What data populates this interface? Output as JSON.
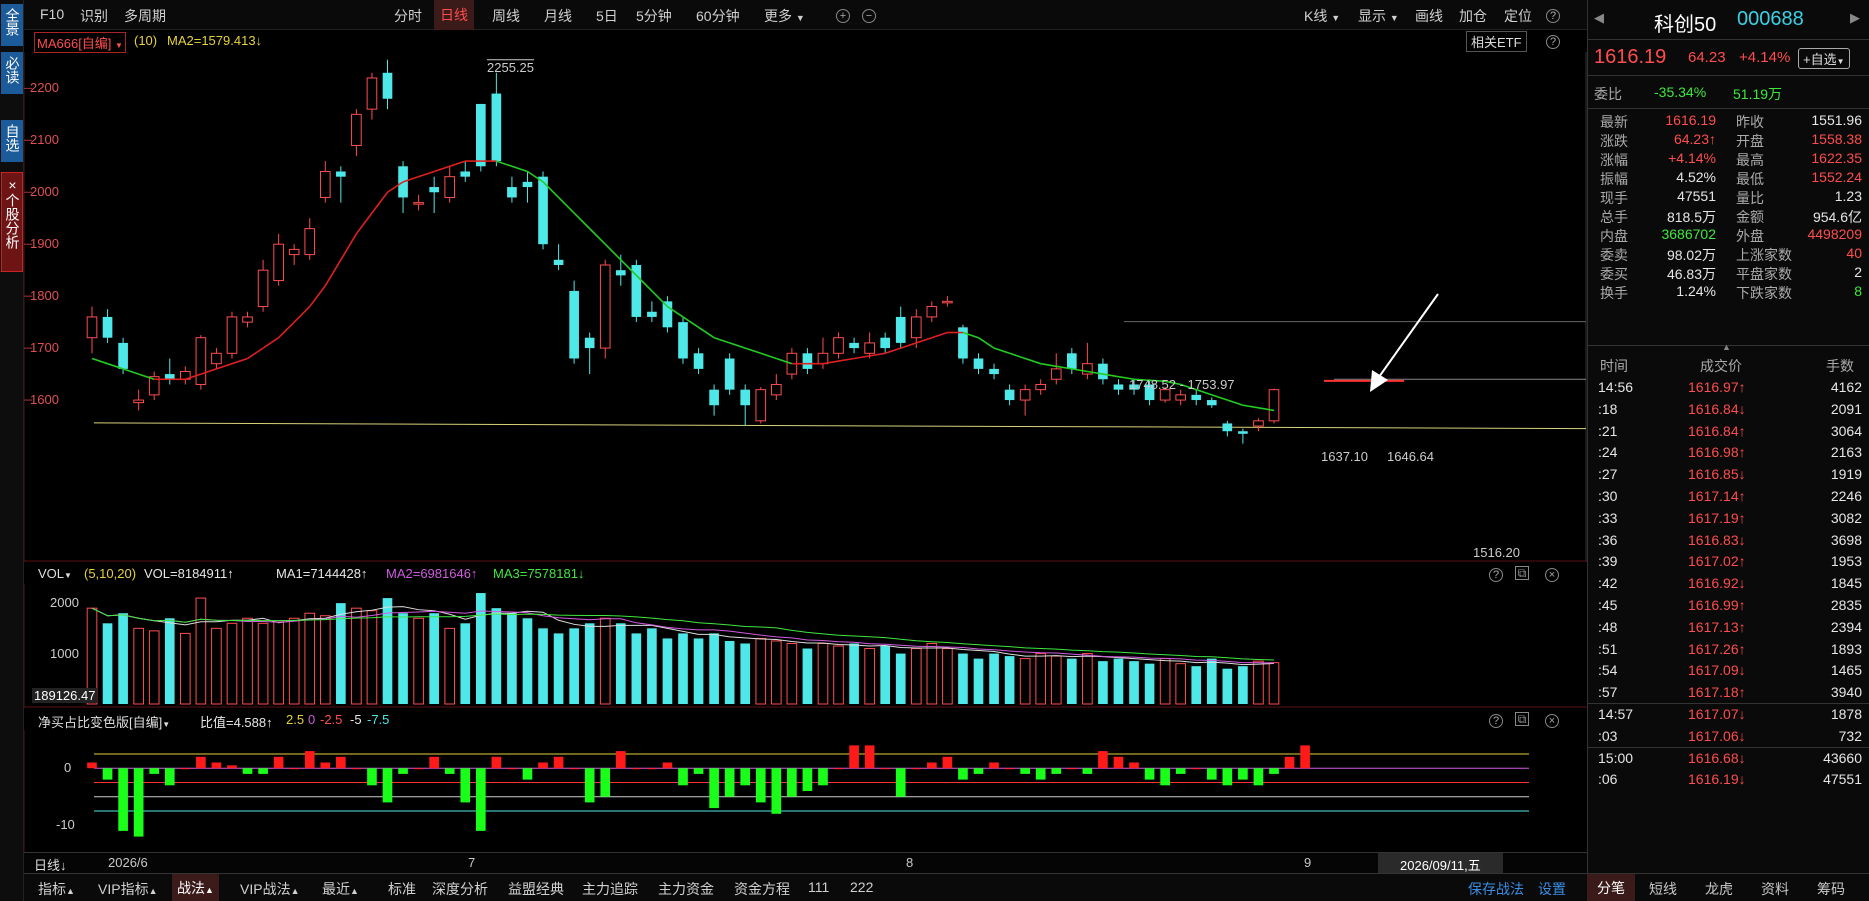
{
  "leftbar": {
    "items": [
      {
        "label": "全景"
      },
      {
        "label": "必读"
      },
      {
        "label": "自选"
      },
      {
        "label": "×个股分析"
      }
    ]
  },
  "topbar": {
    "left": [
      "F10",
      "识别",
      "多周期"
    ],
    "tabs": [
      "分时",
      "日线",
      "周线",
      "月线",
      "5日",
      "5分钟",
      "60分钟",
      "更多"
    ],
    "active_tab": "日线",
    "right": [
      "K线",
      "显示",
      "画线",
      "加仓",
      "定位"
    ]
  },
  "main_chart": {
    "ma_selector": "MA666[自编]",
    "ma_param": "(10)",
    "ma2_label": "MA2=1579.413↓",
    "etf_button": "相关ETF",
    "y_ticks": [
      "2200",
      "2100",
      "2000",
      "1900",
      "1800",
      "1700",
      "1600"
    ],
    "annotations": {
      "high": "2255.25",
      "range1": "1748.52 - 1753.97",
      "p1": "1637.10",
      "p2": "1646.64",
      "low": "1516.20"
    }
  },
  "vol_chart": {
    "selector": "VOL",
    "params": "(5,10,20)",
    "vol": "VOL=8184911↑",
    "ma1": "MA1=7144428↑",
    "ma2": "MA2=6981646↑",
    "ma3": "MA3=7578181↓",
    "y_ticks": [
      "2000",
      "1000"
    ],
    "cursor_value": "189126.47"
  },
  "net_chart": {
    "selector": "净买占比变色版[自编]",
    "ratio": "比值=4.588↑",
    "levels": [
      "2.5",
      "0",
      "-2.5",
      "-5",
      "-7.5"
    ],
    "y_ticks": [
      "0",
      "-10"
    ]
  },
  "x_axis": {
    "period_selector": "日线",
    "labels": [
      "2026/6",
      "7",
      "8",
      "9"
    ],
    "cursor_date": "2026/09/11,五"
  },
  "bottombar": {
    "items": [
      "指标",
      "VIP指标",
      "战法",
      "VIP战法",
      "最近",
      "标准",
      "深度分析",
      "益盟经典",
      "主力追踪",
      "主力资金",
      "资金方程",
      "111",
      "222"
    ],
    "active": "战法",
    "right": [
      "保存战法",
      "设置"
    ]
  },
  "quote": {
    "name": "科创50",
    "code": "000688",
    "price": "1616.19",
    "change": "64.23",
    "pct": "+4.14%",
    "watch_button": "+自选",
    "webi_label": "委比",
    "webi": "-35.34%",
    "wecha": "51.19万",
    "fields": [
      {
        "l": "最新",
        "v": "1616.19",
        "c": "red",
        "l2": "昨收",
        "v2": "1551.96",
        "c2": "white"
      },
      {
        "l": "涨跌",
        "v": "64.23↑",
        "c": "red",
        "l2": "开盘",
        "v2": "1558.38",
        "c2": "red"
      },
      {
        "l": "涨幅",
        "v": "+4.14%",
        "c": "red",
        "l2": "最高",
        "v2": "1622.35",
        "c2": "red"
      },
      {
        "l": "振幅",
        "v": "4.52%",
        "c": "white",
        "l2": "最低",
        "v2": "1552.24",
        "c2": "red"
      },
      {
        "l": "现手",
        "v": "47551",
        "c": "white",
        "l2": "量比",
        "v2": "1.23",
        "c2": "white"
      },
      {
        "l": "总手",
        "v": "818.5万",
        "c": "white",
        "l2": "金额",
        "v2": "954.6亿",
        "c2": "white"
      },
      {
        "l": "内盘",
        "v": "3686702",
        "c": "green",
        "l2": "外盘",
        "v2": "4498209",
        "c2": "red"
      },
      {
        "l": "委卖",
        "v": "98.02万",
        "c": "white",
        "l2": "上涨家数",
        "v2": "40",
        "c2": "red"
      },
      {
        "l": "委买",
        "v": "46.83万",
        "c": "white",
        "l2": "平盘家数",
        "v2": "2",
        "c2": "white"
      },
      {
        "l": "换手",
        "v": "1.24%",
        "c": "white",
        "l2": "下跌家数",
        "v2": "8",
        "c2": "green"
      }
    ],
    "ticks_header": [
      "时间",
      "成交价",
      "手数"
    ],
    "ticks": [
      {
        "t": "14:56",
        "p": "1616.97↑",
        "pc": "red",
        "v": "4162",
        "vc": "white"
      },
      {
        "t": ":18",
        "p": "1616.84↓",
        "pc": "red",
        "v": "2091",
        "vc": "white"
      },
      {
        "t": ":21",
        "p": "1616.84↑",
        "pc": "red",
        "v": "3064",
        "vc": "white"
      },
      {
        "t": ":24",
        "p": "1616.98↑",
        "pc": "red",
        "v": "2163",
        "vc": "white"
      },
      {
        "t": ":27",
        "p": "1616.85↓",
        "pc": "red",
        "v": "1919",
        "vc": "white"
      },
      {
        "t": ":30",
        "p": "1617.14↑",
        "pc": "red",
        "v": "2246",
        "vc": "white"
      },
      {
        "t": ":33",
        "p": "1617.19↑",
        "pc": "red",
        "v": "3082",
        "vc": "white"
      },
      {
        "t": ":36",
        "p": "1616.83↓",
        "pc": "red",
        "v": "3698",
        "vc": "white"
      },
      {
        "t": ":39",
        "p": "1617.02↑",
        "pc": "red",
        "v": "1953",
        "vc": "white"
      },
      {
        "t": ":42",
        "p": "1616.92↓",
        "pc": "red",
        "v": "1845",
        "vc": "white"
      },
      {
        "t": ":45",
        "p": "1616.99↑",
        "pc": "red",
        "v": "2835",
        "vc": "white"
      },
      {
        "t": ":48",
        "p": "1617.13↑",
        "pc": "red",
        "v": "2394",
        "vc": "white"
      },
      {
        "t": ":51",
        "p": "1617.26↑",
        "pc": "red",
        "v": "1893",
        "vc": "white"
      },
      {
        "t": ":54",
        "p": "1617.09↓",
        "pc": "red",
        "v": "1465",
        "vc": "white"
      },
      {
        "t": ":57",
        "p": "1617.18↑",
        "pc": "red",
        "v": "3940",
        "vc": "white"
      },
      {
        "t": "14:57",
        "p": "1617.07↓",
        "pc": "red",
        "v": "1878",
        "vc": "white"
      },
      {
        "t": ":03",
        "p": "1617.06↓",
        "pc": "red",
        "v": "732",
        "vc": "white"
      },
      {
        "t": "15:00",
        "p": "1616.68↓",
        "pc": "red",
        "v": "43660",
        "vc": "white"
      },
      {
        "t": ":06",
        "p": "1616.19↓",
        "pc": "red",
        "v": "47551",
        "vc": "white"
      }
    ],
    "bottom_tabs": [
      "分笔",
      "短线",
      "龙虎",
      "资料",
      "筹码"
    ],
    "active_bottom_tab": "分笔"
  },
  "colors": {
    "up": "#ff4d4d",
    "down": "#4fe8e8",
    "ma_red": "#e02020",
    "ma_green": "#22cc22"
  },
  "chart_data": {
    "type": "candlestick",
    "candles": [
      [
        1720,
        1760,
        1690,
        1780
      ],
      [
        1760,
        1720,
        1710,
        1775
      ],
      [
        1710,
        1660,
        1650,
        1720
      ],
      [
        1595,
        1600,
        1580,
        1620
      ],
      [
        1610,
        1645,
        1600,
        1655
      ],
      [
        1650,
        1640,
        1630,
        1680
      ],
      [
        1640,
        1655,
        1630,
        1665
      ],
      [
        1630,
        1720,
        1620,
        1725
      ],
      [
        1670,
        1690,
        1660,
        1700
      ],
      [
        1690,
        1760,
        1680,
        1770
      ],
      [
        1750,
        1760,
        1740,
        1770
      ],
      [
        1780,
        1850,
        1770,
        1870
      ],
      [
        1830,
        1900,
        1820,
        1920
      ],
      [
        1880,
        1890,
        1860,
        1900
      ],
      [
        1880,
        1930,
        1870,
        1950
      ],
      [
        1990,
        2040,
        1980,
        2060
      ],
      [
        2040,
        2030,
        1980,
        2050
      ],
      [
        2090,
        2150,
        2070,
        2160
      ],
      [
        2160,
        2220,
        2140,
        2230
      ],
      [
        2230,
        2180,
        2160,
        2255
      ],
      [
        2050,
        1990,
        1960,
        2060
      ],
      [
        1980,
        1980,
        1965,
        1995
      ],
      [
        2010,
        2000,
        1960,
        2030
      ],
      [
        1990,
        2030,
        1980,
        2050
      ],
      [
        2040,
        2030,
        2020,
        2060
      ],
      [
        2170,
        2050,
        2040,
        2170
      ],
      [
        2190,
        2060,
        2050,
        2230
      ],
      [
        2010,
        1990,
        1980,
        2030
      ],
      [
        2020,
        2010,
        1980,
        2040
      ],
      [
        2030,
        1900,
        1890,
        2040
      ],
      [
        1870,
        1860,
        1850,
        1900
      ],
      [
        1810,
        1680,
        1670,
        1830
      ],
      [
        1720,
        1700,
        1650,
        1730
      ],
      [
        1700,
        1860,
        1680,
        1870
      ],
      [
        1850,
        1840,
        1820,
        1880
      ],
      [
        1860,
        1760,
        1750,
        1870
      ],
      [
        1770,
        1760,
        1750,
        1790
      ],
      [
        1790,
        1740,
        1730,
        1800
      ],
      [
        1750,
        1680,
        1670,
        1760
      ],
      [
        1690,
        1660,
        1650,
        1700
      ],
      [
        1620,
        1590,
        1570,
        1630
      ],
      [
        1680,
        1620,
        1610,
        1690
      ],
      [
        1620,
        1590,
        1550,
        1630
      ],
      [
        1560,
        1620,
        1555,
        1625
      ],
      [
        1610,
        1630,
        1600,
        1650
      ],
      [
        1650,
        1690,
        1640,
        1700
      ],
      [
        1690,
        1660,
        1650,
        1700
      ],
      [
        1670,
        1690,
        1660,
        1720
      ],
      [
        1690,
        1720,
        1680,
        1730
      ],
      [
        1710,
        1700,
        1690,
        1720
      ],
      [
        1690,
        1710,
        1680,
        1730
      ],
      [
        1720,
        1700,
        1690,
        1730
      ],
      [
        1760,
        1710,
        1700,
        1780
      ],
      [
        1720,
        1760,
        1700,
        1775
      ],
      [
        1760,
        1780,
        1750,
        1790
      ],
      [
        1790,
        1790,
        1780,
        1800
      ],
      [
        1740,
        1680,
        1670,
        1745
      ],
      [
        1680,
        1660,
        1650,
        1690
      ],
      [
        1660,
        1650,
        1640,
        1670
      ],
      [
        1620,
        1600,
        1590,
        1630
      ],
      [
        1600,
        1620,
        1570,
        1630
      ],
      [
        1620,
        1630,
        1610,
        1640
      ],
      [
        1640,
        1660,
        1630,
        1690
      ],
      [
        1690,
        1660,
        1650,
        1700
      ],
      [
        1650,
        1670,
        1640,
        1710
      ],
      [
        1670,
        1640,
        1630,
        1680
      ],
      [
        1630,
        1620,
        1610,
        1640
      ],
      [
        1630,
        1620,
        1610,
        1640
      ],
      [
        1630,
        1600,
        1590,
        1640
      ],
      [
        1600,
        1620,
        1595,
        1625
      ],
      [
        1600,
        1610,
        1590,
        1620
      ],
      [
        1610,
        1600,
        1590,
        1620
      ],
      [
        1600,
        1590,
        1585,
        1605
      ],
      [
        1555,
        1540,
        1530,
        1560
      ],
      [
        1540,
        1535,
        1516,
        1545
      ],
      [
        1550,
        1560,
        1540,
        1565
      ],
      [
        1560,
        1620,
        1555,
        1622
      ]
    ],
    "ma_red_green": [
      1680,
      1670,
      1660,
      1650,
      1640,
      1640,
      1640,
      1650,
      1660,
      1670,
      1680,
      1700,
      1720,
      1750,
      1780,
      1820,
      1870,
      1920,
      1960,
      2000,
      2020,
      2030,
      2040,
      2050,
      2060,
      2060,
      2060,
      2050,
      2040,
      2020,
      1990,
      1960,
      1930,
      1900,
      1870,
      1840,
      1810,
      1780,
      1760,
      1740,
      1720,
      1710,
      1700,
      1690,
      1680,
      1670,
      1670,
      1670,
      1675,
      1680,
      1685,
      1690,
      1700,
      1710,
      1720,
      1730,
      1730,
      1720,
      1700,
      1690,
      1680,
      1670,
      1665,
      1660,
      1655,
      1650,
      1645,
      1640,
      1638,
      1636,
      1630,
      1620,
      1610,
      1600,
      1590,
      1585,
      1580
    ],
    "vol_values": [
      1900,
      1600,
      1800,
      1500,
      1450,
      1700,
      1400,
      2100,
      1500,
      1600,
      1700,
      1600,
      1650,
      1700,
      1800,
      1750,
      2000,
      1900,
      1850,
      2100,
      1800,
      1700,
      1800,
      1500,
      1600,
      2200,
      1900,
      1800,
      1700,
      1500,
      1400,
      1500,
      1600,
      1700,
      1600,
      1400,
      1500,
      1300,
      1400,
      1300,
      1400,
      1250,
      1200,
      1300,
      1250,
      1200,
      1100,
      1200,
      1150,
      1200,
      1100,
      1150,
      1000,
      1100,
      1200,
      1100,
      1000,
      900,
      1000,
      950,
      900,
      1000,
      950,
      900,
      1000,
      850,
      900,
      850,
      800,
      900,
      800,
      750,
      900,
      700,
      750,
      850,
      820
    ],
    "net_values": [
      1,
      -2,
      -11,
      -12,
      -1,
      -3,
      0,
      2,
      1,
      0.5,
      -1,
      -1,
      2,
      0,
      3,
      1,
      2,
      0,
      -3,
      -6,
      -1,
      0,
      2,
      -1,
      -6,
      -11,
      2,
      0,
      -2,
      1,
      2,
      0,
      -6,
      -5,
      3,
      0,
      0,
      1,
      -3,
      -1,
      -7,
      -5,
      -3,
      -6,
      -8,
      -5,
      -4,
      -3,
      0,
      4,
      4,
      0,
      -5,
      0,
      1,
      2,
      -2,
      -1,
      1,
      0,
      -1,
      -2,
      -1,
      0,
      -1,
      3,
      2,
      1,
      -2,
      -3,
      -1,
      0,
      -2,
      -3,
      -2,
      -3,
      -1,
      2,
      4
    ]
  }
}
